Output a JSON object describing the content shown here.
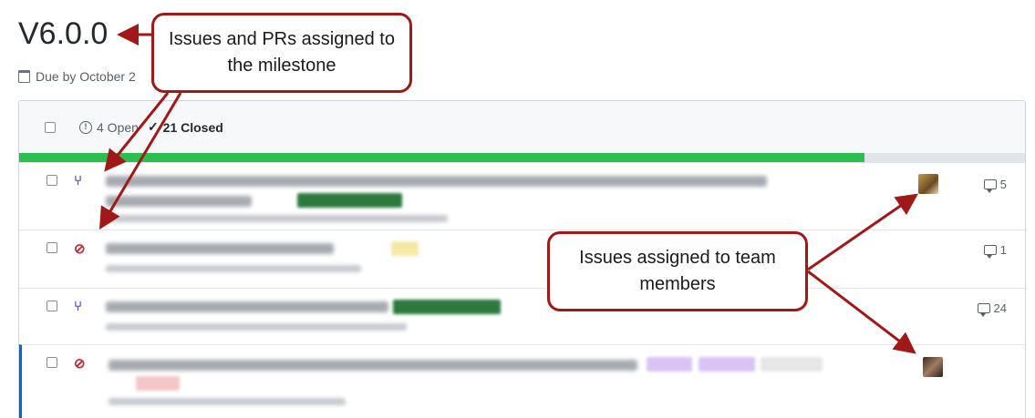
{
  "milestone": {
    "title": "V6.0.0",
    "due_text": "Due by October 2"
  },
  "header": {
    "open_label": "4 Open",
    "closed_label": "21 Closed"
  },
  "progress": {
    "percent": 0.84,
    "color": "#2cbe4e"
  },
  "rows": [
    {
      "type": "pull-request",
      "icon": "pr-merged-icon",
      "comments": "5",
      "has_avatar": true
    },
    {
      "type": "closed-issue",
      "icon": "issue-closed-icon",
      "comments": "1",
      "has_avatar": false
    },
    {
      "type": "pull-request",
      "icon": "pr-merged-icon",
      "comments": "24",
      "has_avatar": false
    },
    {
      "type": "closed-issue",
      "icon": "issue-closed-icon",
      "comments": "",
      "has_avatar": true
    }
  ],
  "callouts": {
    "milestone_items": "Issues and PRs assigned to the milestone",
    "team_members": "Issues assigned to team members"
  },
  "colors": {
    "callout_border": "#a01818",
    "pr_icon": "#6f42c1",
    "closed_issue_icon": "#cb2431",
    "label_green": "#2c7a3e"
  }
}
